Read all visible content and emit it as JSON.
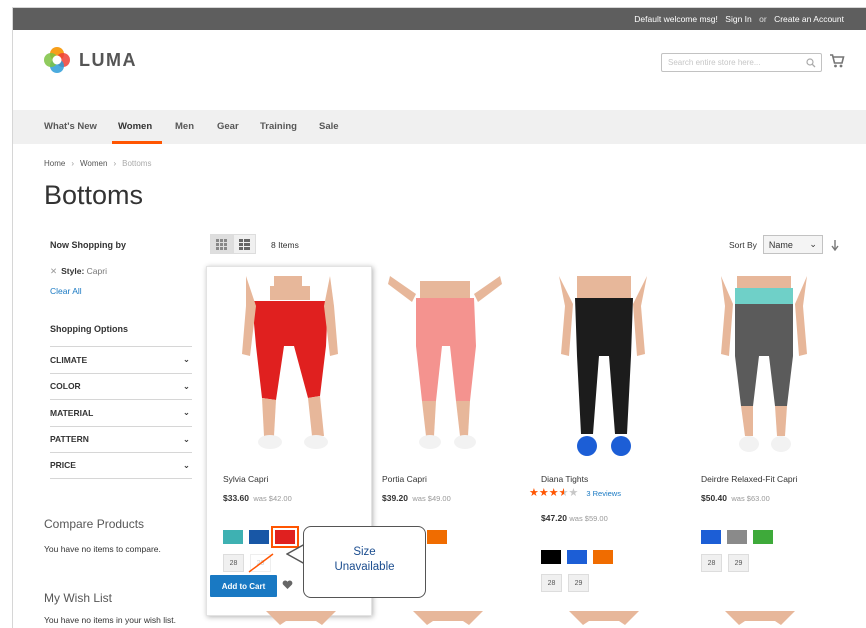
{
  "header": {
    "welcome": "Default welcome msg!",
    "sign_in": "Sign In",
    "or": "or",
    "create_account": "Create an Account",
    "logo_text": "LUMA",
    "search_placeholder": "Search entire store here..."
  },
  "nav": {
    "items": [
      "What's New",
      "Women",
      "Men",
      "Gear",
      "Training",
      "Sale"
    ],
    "active": "Women",
    "accent_color": "#ff5501"
  },
  "breadcrumb": [
    "Home",
    "Women",
    "Bottoms"
  ],
  "page_title": "Bottoms",
  "sidebar": {
    "now_shopping_by": "Now Shopping by",
    "filter_label": "Style:",
    "filter_value": "Capri",
    "clear_all": "Clear All",
    "shopping_options": "Shopping Options",
    "options": [
      "CLIMATE",
      "COLOR",
      "MATERIAL",
      "PATTERN",
      "PRICE"
    ],
    "compare_title": "Compare Products",
    "compare_text": "You have no items to compare.",
    "wishlist_title": "My Wish List",
    "wishlist_text": "You have no items in your wish list."
  },
  "toolbar": {
    "count": "8 Items",
    "sort_label": "Sort By",
    "sort_value": "Name"
  },
  "products": [
    {
      "name": "Sylvia Capri",
      "price": "$33.60",
      "was": "was $42.00",
      "swatches": [
        "#3eb1b2",
        "#1857a6",
        "#e0201f"
      ],
      "selected_swatch": 2,
      "sizes": [
        "28",
        "29"
      ],
      "size_unavailable": 1
    },
    {
      "name": "Portia Capri",
      "price": "$39.20",
      "was": "was $49.00",
      "swatches": [
        "#1c5ed6",
        "#3eaa3a",
        "#f06c00"
      ]
    },
    {
      "name": "Diana Tights",
      "price": "$47.20",
      "was": "was $59.00",
      "rating": 3.5,
      "reviews": "3 Reviews",
      "swatches": [
        "#000000",
        "#1c5ed6",
        "#f06c00"
      ],
      "sizes": [
        "28",
        "29"
      ]
    },
    {
      "name": "Deirdre Relaxed-Fit Capri",
      "price": "$50.40",
      "was": "was $63.00",
      "swatches": [
        "#1c5ed6",
        "#8a8a8a",
        "#3eaa3a"
      ],
      "sizes": [
        "28",
        "29"
      ]
    }
  ],
  "add_to_cart": "Add to Cart",
  "callout": {
    "line1": "Size",
    "line2": "Unavailable"
  }
}
